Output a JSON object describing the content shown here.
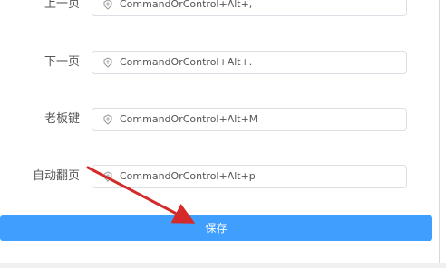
{
  "shortcuts": [
    {
      "label": "上一页",
      "value": "CommandOrControl+Alt+,",
      "icon": "keyboard-icon"
    },
    {
      "label": "下一页",
      "value": "CommandOrControl+Alt+.",
      "icon": "keyboard-icon"
    },
    {
      "label": "老板键",
      "value": "CommandOrControl+Alt+M",
      "icon": "keyboard-icon"
    },
    {
      "label": "自动翻页",
      "value": "CommandOrControl+Alt+p",
      "icon": "keyboard-icon"
    }
  ],
  "save_button": {
    "label": "保存"
  },
  "colors": {
    "primary": "#409eff",
    "annotation_arrow": "#d42a2a"
  }
}
